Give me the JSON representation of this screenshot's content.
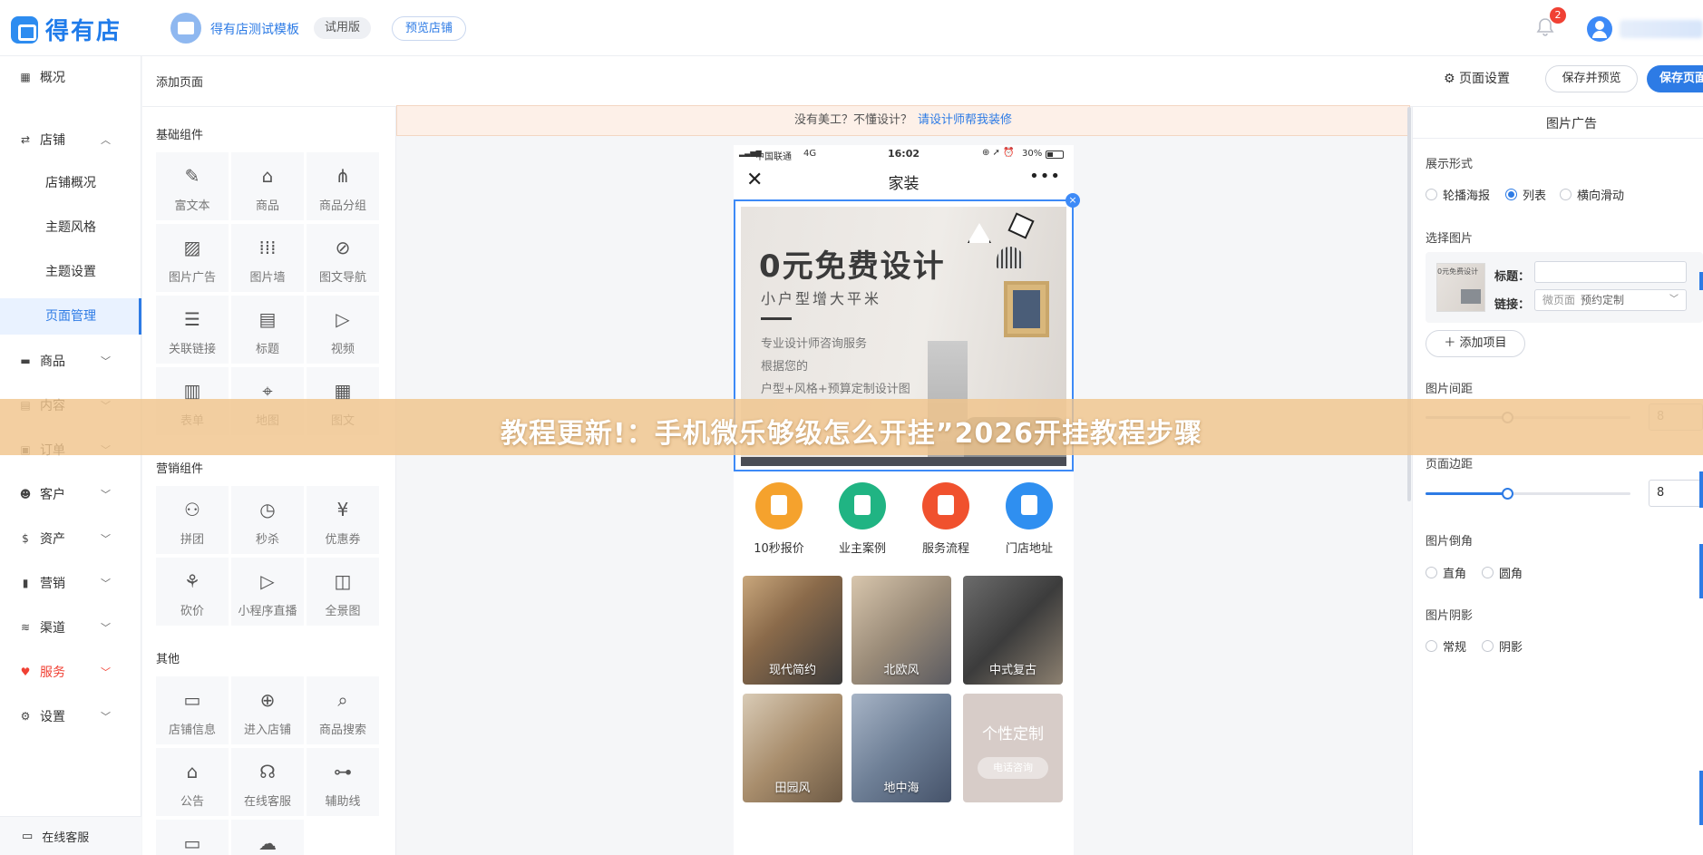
{
  "brand": {
    "logo_text": "得有店"
  },
  "topbar": {
    "store_name": "得有店测试模板",
    "trial_tag": "试用版",
    "preview_store": "预览店铺",
    "notification_count": "2"
  },
  "sidebar": {
    "overview": "概况",
    "store": "店铺",
    "store_sub": [
      "店铺概况",
      "主题风格",
      "主题设置",
      "页面管理"
    ],
    "items": [
      "商品",
      "内容",
      "订单",
      "客户",
      "资产",
      "营销",
      "渠道",
      "服务",
      "设置"
    ],
    "online_service": "在线客服"
  },
  "header": {
    "breadcrumb": "添加页面",
    "page_settings": "页面设置",
    "save_preview": "保存并预览",
    "save_page": "保存页面"
  },
  "components": {
    "basic_title": "基础组件",
    "basic": [
      "富文本",
      "商品",
      "商品分组",
      "图片广告",
      "图片墙",
      "图文导航",
      "关联链接",
      "标题",
      "视频",
      "表单",
      "地图",
      "图文"
    ],
    "marketing_title": "营销组件",
    "marketing": [
      "拼团",
      "秒杀",
      "优惠券",
      "砍价",
      "小程序直播",
      "全景图"
    ],
    "other_title": "其他",
    "other": [
      "店铺信息",
      "进入店铺",
      "商品搜索",
      "公告",
      "在线客服",
      "辅助线"
    ]
  },
  "tip": {
    "text": "没有美工？不懂设计？",
    "link": "请设计师帮我装修"
  },
  "phone": {
    "status": {
      "carrier": "中国联通",
      "network": "4G",
      "time": "16:02",
      "battery": "30%"
    },
    "title": "家装",
    "banner": {
      "headline": "0元免费设计",
      "subline": "小户型增大平米",
      "lines": [
        "专业设计师咨询服务",
        "根据您的",
        "户型+风格+预算定制设计图"
      ]
    },
    "nav_icons": [
      {
        "label": "10秒报价",
        "color": "#f5a22d"
      },
      {
        "label": "业主案例",
        "color": "#20b483"
      },
      {
        "label": "服务流程",
        "color": "#f0512e"
      },
      {
        "label": "门店地址",
        "color": "#2f8ff0"
      }
    ],
    "styles": [
      "现代简约",
      "北欧风",
      "中式复古",
      "田园风",
      "地中海"
    ],
    "custom": {
      "title": "个性定制",
      "button": "电话咨询"
    }
  },
  "props": {
    "title": "图片广告",
    "display_label": "展示形式",
    "display_options": [
      "轮播海报",
      "列表",
      "横向滑动"
    ],
    "display_selected": "列表",
    "select_image_label": "选择图片",
    "thumb_text": "0元免费设计",
    "field_title_label": "标题：",
    "field_title_value": "",
    "field_link_label": "链接：",
    "field_link_prefix": "微页面",
    "field_link_value": "预约定制",
    "add_item": "＋ 添加项目",
    "spacing_label": "图片间距",
    "spacing_value": "8",
    "margin_label": "页面边距",
    "margin_value": "8",
    "radius_label": "图片倒角",
    "radius_options": [
      "直角",
      "圆角"
    ],
    "shadow_label": "图片阴影",
    "shadow_options": [
      "常规",
      "阴影"
    ]
  },
  "overlay": {
    "text": "教程更新!：手机微乐够级怎么开挂”2026开挂教程步骤"
  }
}
